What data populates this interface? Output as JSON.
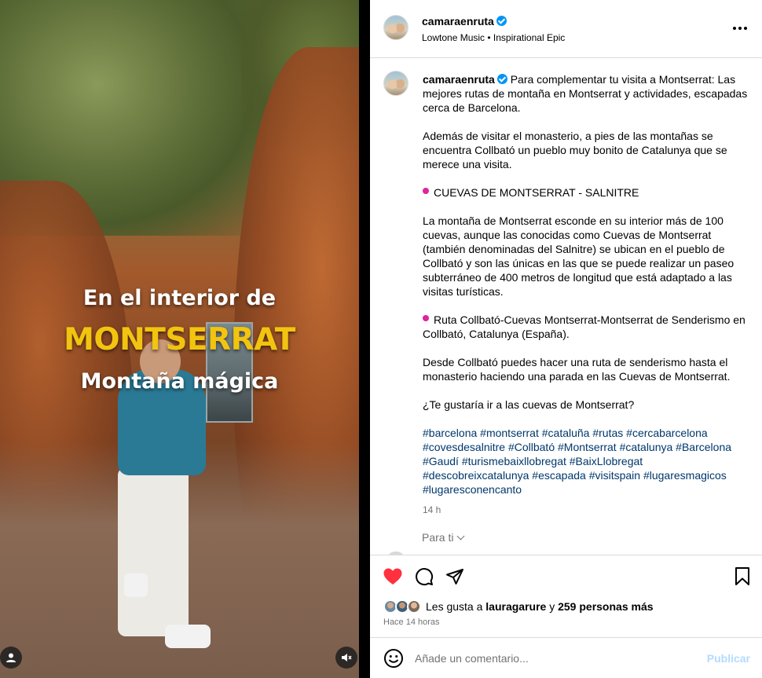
{
  "media": {
    "overlay_line1": "En el interior de",
    "overlay_line2": "MONTSERRAT",
    "overlay_line3": "Montaña mágica",
    "overlay_colors": {
      "primary": "#ffffff",
      "accent": "#f2c40f"
    },
    "tagged_user_icon": "user-icon",
    "audio_icon": "muted-speaker-icon"
  },
  "header": {
    "username": "camaraenruta",
    "verified": true,
    "music": "Lowtone Music • Inspirational Epic",
    "more_icon": "more-horizontal-icon"
  },
  "caption": {
    "username": "camaraenruta",
    "intro": "Para complementar tu visita a Montserrat: Las mejores rutas de montaña en Montserrat y actividades, escapadas cerca de Barcelona.",
    "para2": "Además de visitar el monasterio, a pies de las montañas se encuentra Collbató un pueblo muy bonito de Catalunya que se merece una visita.",
    "pin1": "CUEVAS DE MONTSERRAT - SALNITRE",
    "para3": "La montaña de Montserrat esconde en su interior más de 100 cuevas, aunque las conocidas como Cuevas de Montserrat (también denominadas del Salnitre) se ubican en el pueblo de Collbató y son las únicas en las que se puede realizar un paseo subterráneo de 400 metros de longitud que está adaptado a las visitas turísticas.",
    "pin2": "Ruta Collbató-Cuevas Montserrat-Montserrat de Senderismo en Collbató, Catalunya (España).",
    "para4": "Desde Collbató puedes hacer una ruta de senderismo hasta el monasterio haciendo una parada en las Cuevas de Montserrat.",
    "question": "¿Te gustaría ir a las cuevas de Montserrat?",
    "hashtags": "#barcelona #montserrat #cataluña #rutas #cercabarcelona #covesdesalnitre #Collbató #Montserrat #catalunya #Barcelona #Gaudí #turismebaixllobregat #BaixLlobregat #descobreixcatalunya #escapada #visitspain #lugaresmagicos #lugaresconencanto",
    "pin_color": "#e0249a",
    "hashtag_color": "#00376b",
    "time": "14 h"
  },
  "translate": {
    "label": "Para ti"
  },
  "actions": {
    "like_icon": "heart-filled-icon",
    "comment_icon": "comment-icon",
    "share_icon": "send-icon",
    "save_icon": "bookmark-icon",
    "like_color": "#ff3040"
  },
  "likes": {
    "prefix": "Les gusta a",
    "user": "lauragarure",
    "connector": "y",
    "others": "259 personas más",
    "ago": "Hace 14 horas"
  },
  "add_comment": {
    "emoji_icon": "emoji-smile-icon",
    "placeholder": "Añade un comentario...",
    "publish_label": "Publicar",
    "publish_color": "#b3dbff"
  }
}
